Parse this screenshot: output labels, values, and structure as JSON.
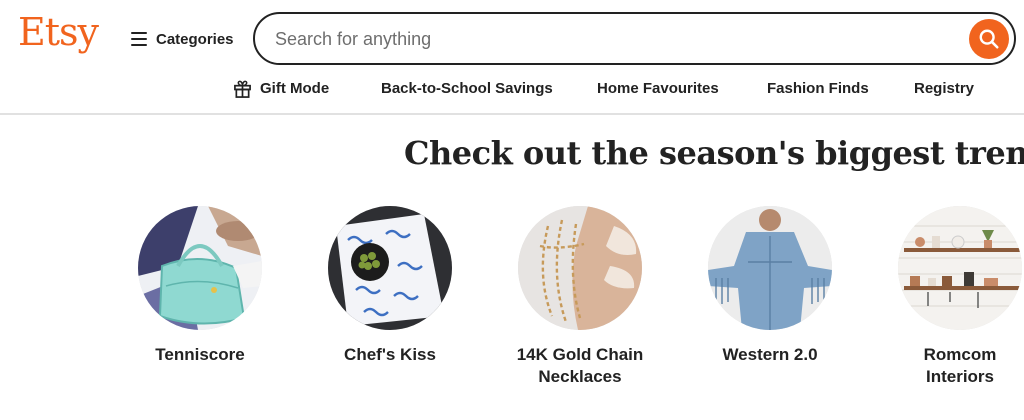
{
  "brand": {
    "logo": "Etsy",
    "color": "#f1641e"
  },
  "header": {
    "categories_label": "Categories",
    "search_placeholder": "Search for anything",
    "search_icon": "search-icon"
  },
  "nav": {
    "items": [
      {
        "label": "Gift Mode",
        "icon": "gift-icon"
      },
      {
        "label": "Back-to-School Savings"
      },
      {
        "label": "Home Favourites"
      },
      {
        "label": "Fashion Finds"
      },
      {
        "label": "Registry"
      }
    ]
  },
  "main": {
    "headline": "Check out the season's biggest trends",
    "trends": [
      {
        "label": "Tenniscore"
      },
      {
        "label": "Chef's Kiss"
      },
      {
        "label": "14K Gold Chain Necklaces"
      },
      {
        "label": "Western 2.0"
      },
      {
        "label": "Romcom Interiors"
      }
    ]
  }
}
